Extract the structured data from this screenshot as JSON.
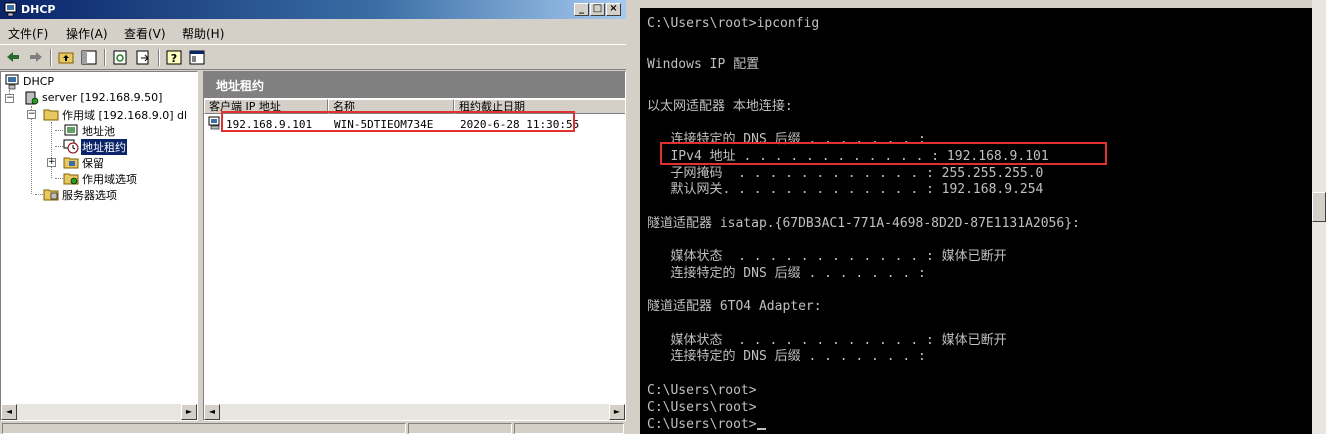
{
  "window": {
    "title": "DHCP",
    "controls": [
      "_",
      "□",
      "×"
    ]
  },
  "menu": [
    {
      "label": "文件(F)"
    },
    {
      "label": "操作(A)"
    },
    {
      "label": "查看(V)"
    },
    {
      "label": "帮助(H)"
    }
  ],
  "toolbar": {
    "icons": [
      "back-arrow-icon",
      "forward-arrow-icon",
      "up-folder-icon",
      "show-tree-icon",
      "refresh-icon",
      "export-icon",
      "help-icon",
      "properties-icon"
    ]
  },
  "tree": {
    "root": "DHCP",
    "server": "server [192.168.9.50]",
    "scope": "作用域 [192.168.9.0] dl",
    "address_pool": "地址池",
    "address_leases": "地址租约",
    "reservations": "保留",
    "scope_options": "作用域选项",
    "server_options": "服务器选项",
    "expanded_sign": "−",
    "collapsed_sign": "+"
  },
  "detail": {
    "header": "地址租约",
    "columns": [
      "客户端 IP 地址",
      "名称",
      "租约截止日期"
    ],
    "rows": [
      {
        "ip": "192.168.9.101",
        "name": "WIN-5DTIEOM734E",
        "expires": "2020-6-28 11:30:55"
      }
    ]
  },
  "scroll_arrows": {
    "left": "◄",
    "right": "►"
  },
  "console": {
    "lines": [
      "C:\\Users\\root>ipconfig",
      "",
      "Windows IP 配置",
      "",
      "",
      "以太网适配器 本地连接:",
      "",
      "   连接特定的 DNS 后缀 . . . . . . . :",
      "   IPv4 地址 . . . . . . . . . . . . : 192.168.9.101",
      "   子网掩码  . . . . . . . . . . . . : 255.255.255.0",
      "   默认网关. . . . . . . . . . . . . : 192.168.9.254",
      "",
      "隧道适配器 isatap.{67DB3AC1-771A-4698-8D2D-87E1131A2056}:",
      "",
      "   媒体状态  . . . . . . . . . . . . : 媒体已断开",
      "   连接特定的 DNS 后缀 . . . . . . . :",
      "",
      "隧道适配器 6TO4 Adapter:",
      "",
      "   媒体状态  . . . . . . . . . . . . : 媒体已断开",
      "   连接特定的 DNS 后缀 . . . . . . . :",
      "",
      "C:\\Users\\root>",
      "C:\\Users\\root>",
      "C:\\Users\\root>"
    ]
  },
  "colors": {
    "highlight_box": "#e03030",
    "selection": "#0a246a",
    "console_bg": "#000000",
    "console_fg": "#c0c0c0"
  }
}
